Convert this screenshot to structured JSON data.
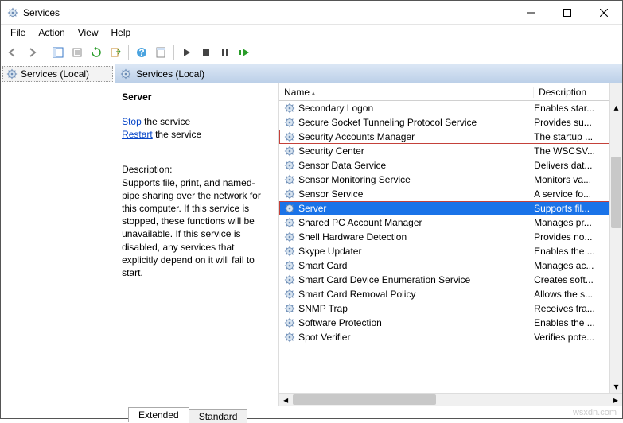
{
  "window": {
    "title": "Services"
  },
  "menu": {
    "file": "File",
    "action": "Action",
    "view": "View",
    "help": "Help"
  },
  "tree": {
    "root": "Services (Local)"
  },
  "band": {
    "title": "Services (Local)"
  },
  "detail": {
    "service_name": "Server",
    "stop_text": "Stop",
    "stop_suffix": " the service",
    "restart_text": "Restart",
    "restart_suffix": " the service",
    "desc_label": "Description:",
    "desc_body": "Supports file, print, and named-pipe sharing over the network for this computer. If this service is stopped, these functions will be unavailable. If this service is disabled, any services that explicitly depend on it will fail to start."
  },
  "columns": {
    "name": "Name",
    "desc": "Description"
  },
  "services": [
    {
      "name": "Secondary Logon",
      "desc": "Enables star...",
      "sel": false,
      "boxed": false
    },
    {
      "name": "Secure Socket Tunneling Protocol Service",
      "desc": "Provides su...",
      "sel": false,
      "boxed": false
    },
    {
      "name": "Security Accounts Manager",
      "desc": "The startup ...",
      "sel": false,
      "boxed": true
    },
    {
      "name": "Security Center",
      "desc": "The WSCSV...",
      "sel": false,
      "boxed": false
    },
    {
      "name": "Sensor Data Service",
      "desc": "Delivers dat...",
      "sel": false,
      "boxed": false
    },
    {
      "name": "Sensor Monitoring Service",
      "desc": "Monitors va...",
      "sel": false,
      "boxed": false
    },
    {
      "name": "Sensor Service",
      "desc": "A service fo...",
      "sel": false,
      "boxed": false
    },
    {
      "name": "Server",
      "desc": "Supports fil...",
      "sel": true,
      "boxed": true
    },
    {
      "name": "Shared PC Account Manager",
      "desc": "Manages pr...",
      "sel": false,
      "boxed": false
    },
    {
      "name": "Shell Hardware Detection",
      "desc": "Provides no...",
      "sel": false,
      "boxed": false
    },
    {
      "name": "Skype Updater",
      "desc": "Enables the ...",
      "sel": false,
      "boxed": false
    },
    {
      "name": "Smart Card",
      "desc": "Manages ac...",
      "sel": false,
      "boxed": false
    },
    {
      "name": "Smart Card Device Enumeration Service",
      "desc": "Creates soft...",
      "sel": false,
      "boxed": false
    },
    {
      "name": "Smart Card Removal Policy",
      "desc": "Allows the s...",
      "sel": false,
      "boxed": false
    },
    {
      "name": "SNMP Trap",
      "desc": "Receives tra...",
      "sel": false,
      "boxed": false
    },
    {
      "name": "Software Protection",
      "desc": "Enables the ...",
      "sel": false,
      "boxed": false
    },
    {
      "name": "Spot Verifier",
      "desc": "Verifies pote...",
      "sel": false,
      "boxed": false
    }
  ],
  "tabs": {
    "extended": "Extended",
    "standard": "Standard"
  },
  "watermark": "wsxdn.com"
}
